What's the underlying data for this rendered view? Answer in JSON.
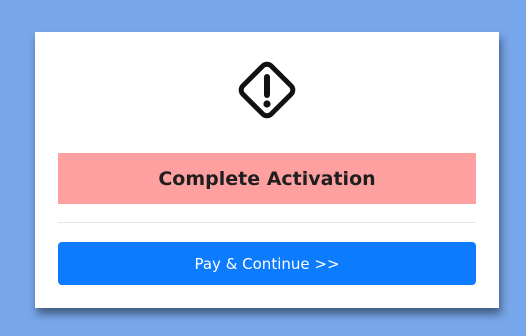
{
  "dialog": {
    "icon": "warning-diamond-icon",
    "banner_text": "Complete Activation",
    "button_label": "Pay & Continue >>"
  },
  "colors": {
    "page_background": "#78a6ea",
    "banner_background": "#ffa0a0",
    "button_background": "#0d7bfd",
    "button_text": "#ffffff"
  }
}
